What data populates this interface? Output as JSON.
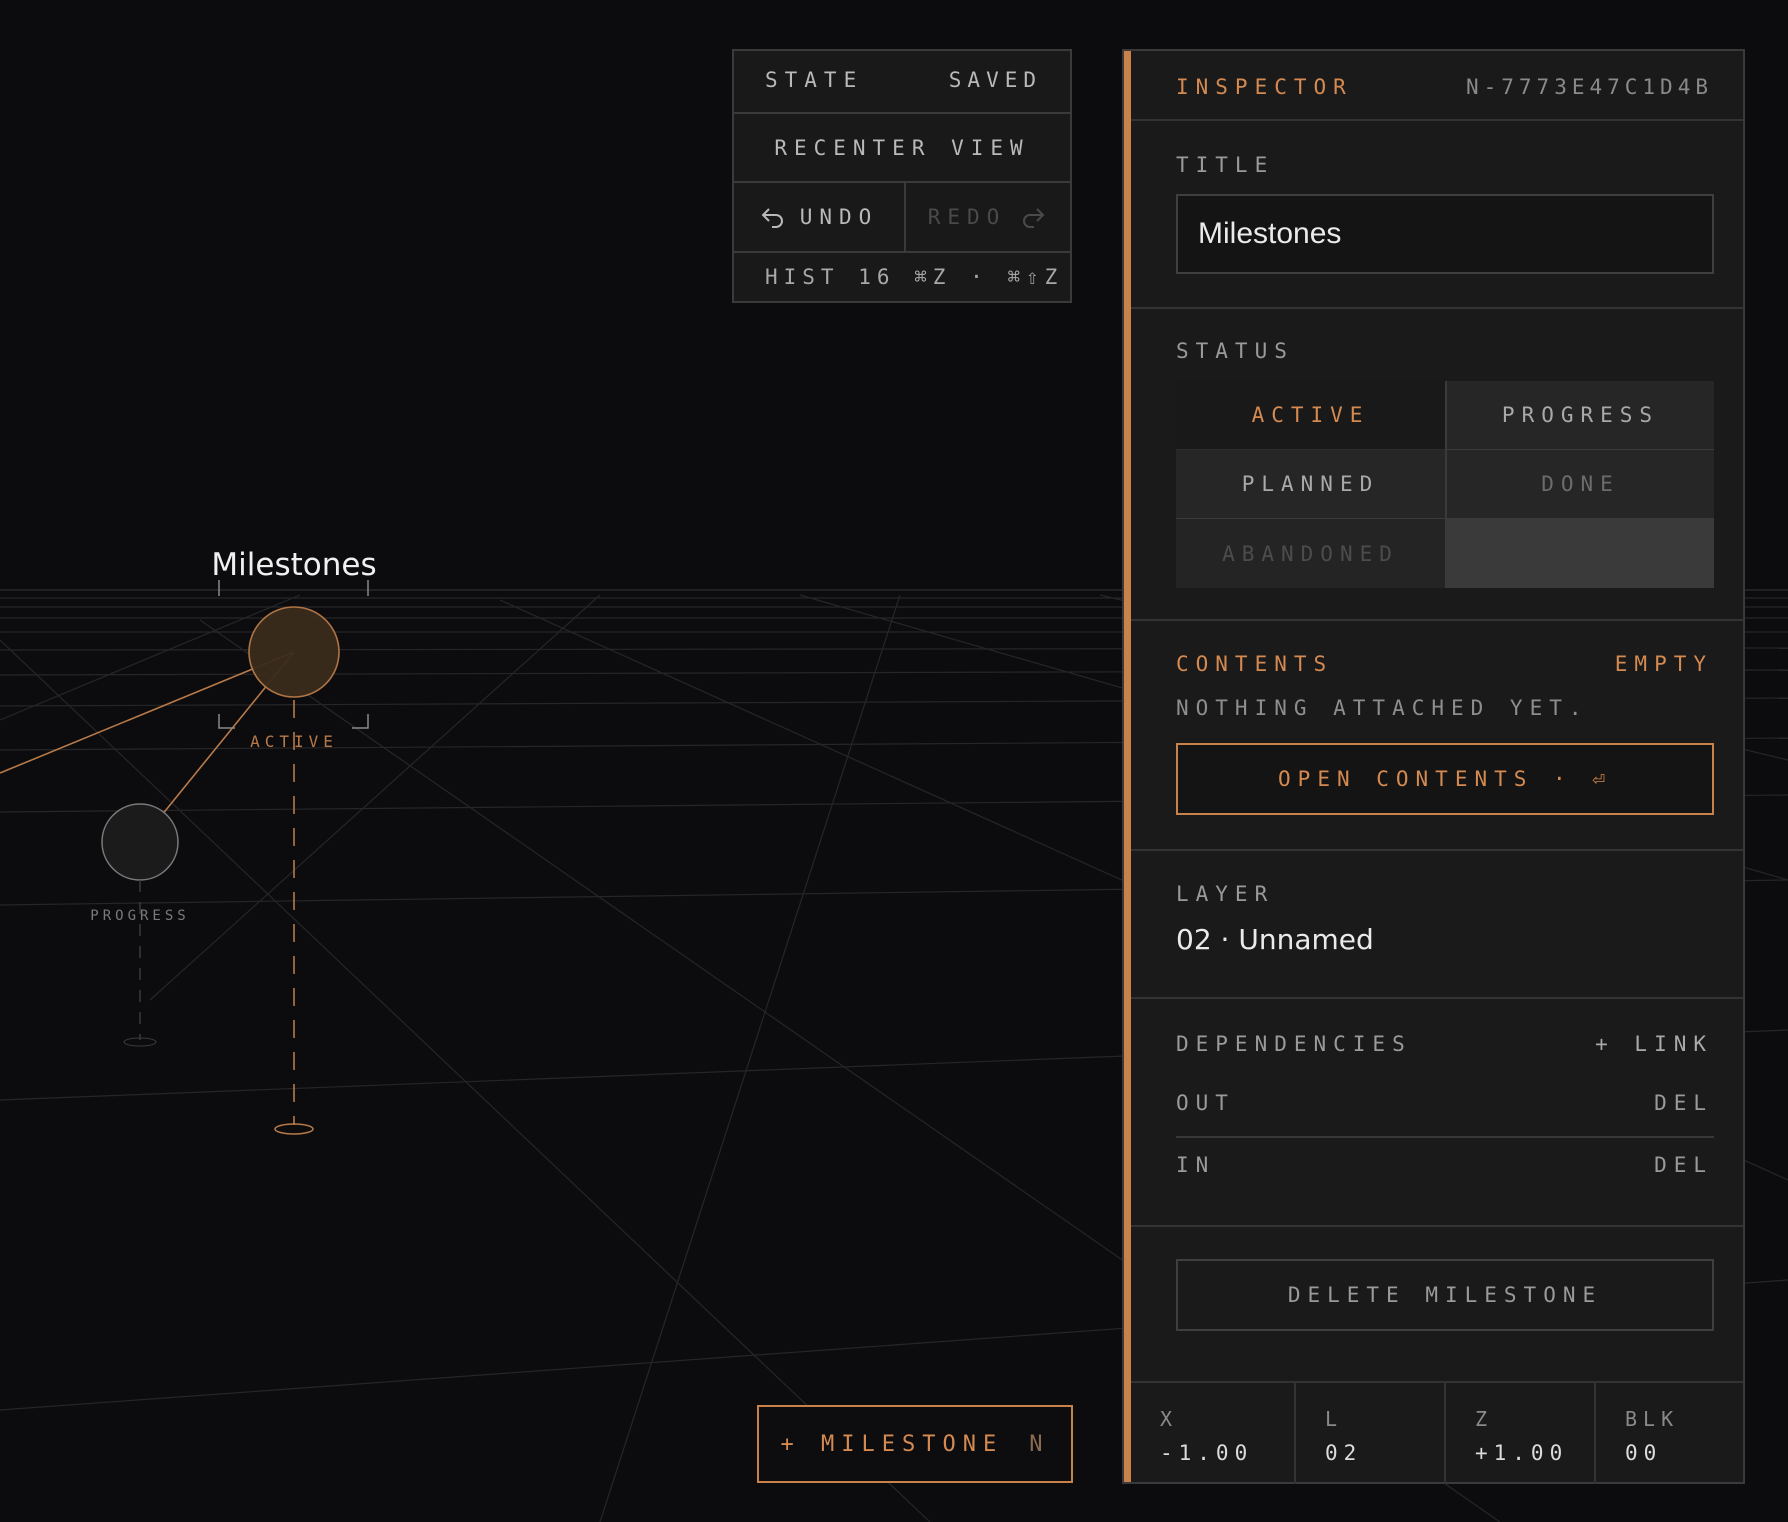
{
  "history": {
    "state_label": "STATE",
    "state_value": "SAVED",
    "recenter_label": "RECENTER VIEW",
    "undo_label": "UNDO",
    "redo_label": "REDO",
    "hist_line": "HIST 16 ⌘Z · ⌘⇧Z",
    "undo_icon": "undo-arrow-icon",
    "redo_icon": "redo-arrow-icon"
  },
  "canvas": {
    "node_title": "Milestones",
    "active_node_label": "ACTIVE",
    "progress_node_label": "PROGRESS"
  },
  "add_milestone": {
    "label": "+ MILESTONE",
    "shortcut": "N"
  },
  "inspector": {
    "title": "INSPECTOR",
    "node_id": "N-7773E47C1D4B",
    "title_label": "TITLE",
    "title_value": "Milestones",
    "status_label": "STATUS",
    "status_options": [
      "ACTIVE",
      "PROGRESS",
      "PLANNED",
      "DONE",
      "ABANDONED"
    ],
    "status_selected": "ACTIVE",
    "contents_label": "CONTENTS",
    "contents_state": "EMPTY",
    "contents_note": "NOTHING ATTACHED YET.",
    "open_contents_label": "OPEN CONTENTS · ⏎",
    "layer_label": "LAYER",
    "layer_value": "02 · Unnamed",
    "dependencies_label": "DEPENDENCIES",
    "link_label": "+ LINK",
    "dep_out_label": "OUT",
    "dep_in_label": "IN",
    "del_label": "DEL",
    "delete_label": "DELETE MILESTONE",
    "coords": [
      {
        "key": "X",
        "value": "-1.00"
      },
      {
        "key": "L",
        "value": "02"
      },
      {
        "key": "Z",
        "value": "+1.00"
      },
      {
        "key": "BLK",
        "value": "00"
      }
    ]
  },
  "colors": {
    "background": "#0c0c0e",
    "panel": "#1a1a1b",
    "accent": "#c8824a",
    "accent_text": "#d48a50",
    "border": "#3a3a3a"
  }
}
